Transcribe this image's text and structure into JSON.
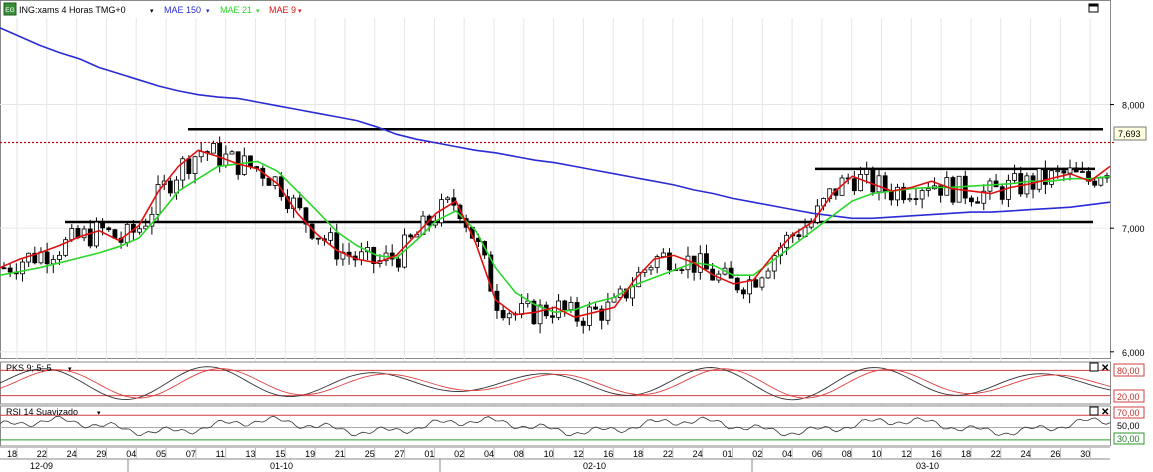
{
  "header": {
    "symbol_badge": "EG",
    "instrument": "ING:xams 4 Horas TMG+0",
    "ma150_label": "MAE 150",
    "ma21_label": "MAE 21",
    "ma9_label": "MAE 9"
  },
  "colors": {
    "price_up": "#ffffff",
    "price_down": "#000000",
    "ma150": "#2b2bd6",
    "ma21": "#2bd62b",
    "ma9": "#e01010",
    "last_price_line": "#c00000",
    "level_line": "#000000",
    "osc_band": "#d04040",
    "rsi_band_low": "#2a9a2a",
    "price_label_bg": "#ffffe0",
    "grid": "#e6e6e6"
  },
  "panels": {
    "pks": {
      "label": "PKS 9; 5; 5",
      "levels": [
        "80,00",
        "20,00"
      ]
    },
    "rsi": {
      "label": "RSI 14 Suavizado",
      "levels": [
        "70,00",
        "50,00",
        "30,00"
      ]
    }
  },
  "chart_data": {
    "type": "candlestick",
    "title": "ING:xams 4 Horas TMG+0",
    "ylim": [
      5.95,
      8.7
    ],
    "yticks": [
      "8,000",
      "7,000",
      "6,000"
    ],
    "last_price": 7.693,
    "last_price_label": "7,693",
    "horizontal_levels": [
      {
        "y": 7.8,
        "from_day": "07",
        "to_day": "31"
      },
      {
        "y": 7.48,
        "from_day": "06",
        "to_day": "30"
      },
      {
        "y": 7.05,
        "from_day": "22",
        "to_day": "30"
      }
    ],
    "x_day_labels": [
      "18",
      "22",
      "24",
      "29",
      "04",
      "05",
      "07",
      "11",
      "13",
      "15",
      "19",
      "21",
      "25",
      "27",
      "01",
      "02",
      "04",
      "08",
      "10",
      "12",
      "16",
      "18",
      "22",
      "24",
      "01",
      "02",
      "04",
      "06",
      "08",
      "10",
      "12",
      "16",
      "18",
      "22",
      "24",
      "26",
      "30"
    ],
    "x_month_labels": [
      "12-09",
      "01-10",
      "02-10",
      "03-10"
    ],
    "series": [
      {
        "name": "MAE 150",
        "values": [
          8.62,
          8.55,
          8.48,
          8.42,
          8.37,
          8.3,
          8.25,
          8.2,
          8.15,
          8.11,
          8.08,
          8.06,
          8.05,
          8.02,
          7.99,
          7.96,
          7.93,
          7.9,
          7.87,
          7.82,
          7.76,
          7.72,
          7.69,
          7.66,
          7.63,
          7.61,
          7.58,
          7.55,
          7.53,
          7.5,
          7.47,
          7.44,
          7.41,
          7.38,
          7.35,
          7.31,
          7.28,
          7.24,
          7.21,
          7.18,
          7.15,
          7.12,
          7.1,
          7.08,
          7.08,
          7.09,
          7.1,
          7.11,
          7.12,
          7.13,
          7.13,
          7.14,
          7.15,
          7.16,
          7.17,
          7.19,
          7.21
        ]
      },
      {
        "name": "MAE 21",
        "values": [
          6.62,
          6.65,
          6.68,
          6.72,
          6.76,
          6.8,
          6.85,
          6.92,
          7.1,
          7.3,
          7.4,
          7.5,
          7.52,
          7.54,
          7.46,
          7.3,
          7.14,
          6.97,
          6.86,
          6.78,
          6.76,
          6.9,
          7.06,
          7.14,
          6.98,
          6.68,
          6.48,
          6.38,
          6.32,
          6.34,
          6.4,
          6.44,
          6.54,
          6.6,
          6.66,
          6.72,
          6.7,
          6.62,
          6.62,
          6.74,
          6.86,
          6.98,
          7.1,
          7.22,
          7.28,
          7.3,
          7.32,
          7.33,
          7.33,
          7.34,
          7.35,
          7.36,
          7.38,
          7.38,
          7.4,
          7.4,
          7.42
        ]
      },
      {
        "name": "MAE 9",
        "values": [
          6.68,
          6.75,
          6.8,
          6.86,
          6.93,
          6.98,
          6.9,
          7.02,
          7.3,
          7.5,
          7.63,
          7.58,
          7.52,
          7.48,
          7.36,
          7.12,
          6.95,
          6.82,
          6.75,
          6.72,
          6.78,
          6.95,
          7.12,
          7.22,
          6.88,
          6.42,
          6.3,
          6.32,
          6.36,
          6.28,
          6.32,
          6.36,
          6.58,
          6.75,
          6.78,
          6.72,
          6.62,
          6.55,
          6.58,
          6.78,
          6.95,
          7.05,
          7.28,
          7.42,
          7.36,
          7.3,
          7.33,
          7.38,
          7.32,
          7.3,
          7.28,
          7.33,
          7.36,
          7.4,
          7.44,
          7.38,
          7.5
        ]
      }
    ],
    "oscillators": {
      "pks_levels": [
        80,
        20
      ],
      "rsi_levels": [
        70,
        50,
        30
      ]
    }
  }
}
